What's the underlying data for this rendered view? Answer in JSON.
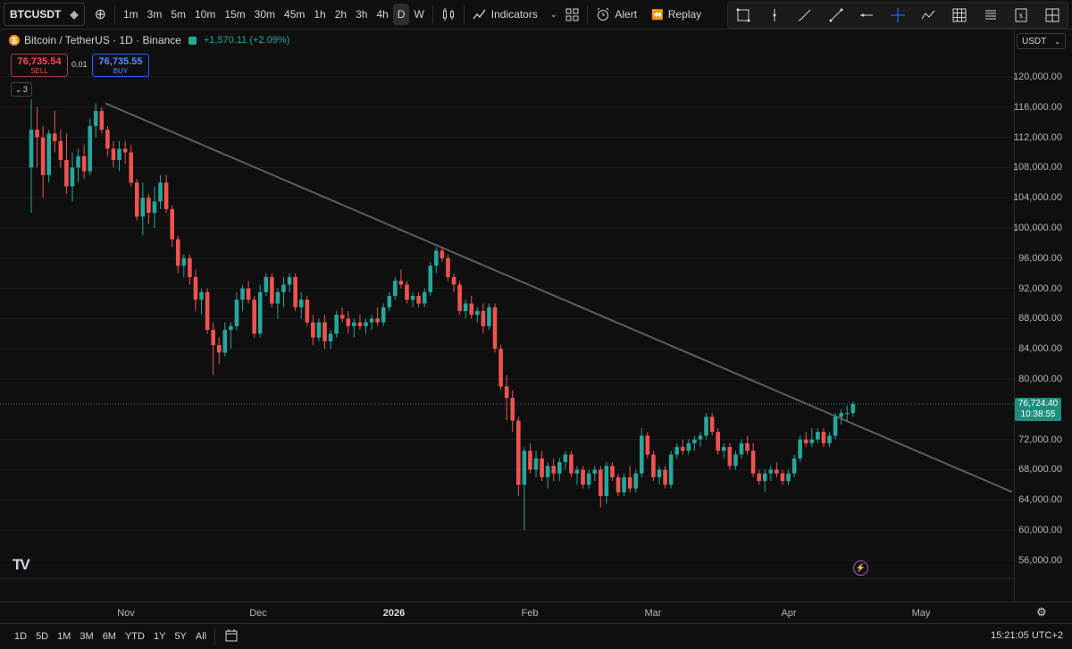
{
  "toolbar": {
    "symbol": "BTCUSDT",
    "intervals": [
      "1m",
      "3m",
      "5m",
      "10m",
      "15m",
      "30m",
      "45m",
      "1h",
      "2h",
      "3h",
      "4h",
      "D",
      "W"
    ],
    "active_interval": "D",
    "indicators_label": "Indicators",
    "alert_label": "Alert",
    "replay_label": "Replay"
  },
  "drawing_tools": [
    "rectangle-icon",
    "vertical-line-icon",
    "brush-icon",
    "trend-line-icon",
    "horizontal-ray-icon",
    "crosshair-icon",
    "path-icon",
    "grid-icon",
    "list-icon",
    "price-range-icon",
    "projection-icon"
  ],
  "legend": {
    "title": "Bitcoin / TetherUS · 1D · Binance",
    "change": "+1,570.11 (+2.09%)"
  },
  "trade": {
    "sell_price": "76,735.54",
    "sell_label": "SELL",
    "spread": "0.01",
    "buy_price": "76,735.55",
    "buy_label": "BUY"
  },
  "indicator_count": "3",
  "currency": "USDT",
  "price_scale": [
    "120,000.00",
    "116,000.00",
    "112,000.00",
    "108,000.00",
    "104,000.00",
    "100,000.00",
    "96,000.00",
    "92,000.00",
    "88,000.00",
    "84,000.00",
    "80,000.00",
    "72,000.00",
    "68,000.00",
    "64,000.00",
    "60,000.00",
    "56,000.00"
  ],
  "last_price": {
    "value": "76,724.40",
    "countdown": "10:38:55"
  },
  "time_scale": [
    {
      "label": "Nov",
      "bold": false
    },
    {
      "label": "Dec",
      "bold": false
    },
    {
      "label": "2026",
      "bold": true
    },
    {
      "label": "Feb",
      "bold": false
    },
    {
      "label": "Mar",
      "bold": false
    },
    {
      "label": "Apr",
      "bold": false
    },
    {
      "label": "May",
      "bold": false
    }
  ],
  "ranges": [
    "1D",
    "5D",
    "1M",
    "3M",
    "6M",
    "YTD",
    "1Y",
    "5Y",
    "All"
  ],
  "clock": "15:21:05 UTC+2",
  "colors": {
    "up": "#26a69a",
    "down": "#ef5350",
    "bg": "#0f0f0f",
    "grid": "#1c1c1c",
    "trendline": "#5d5d5d"
  },
  "chart_data": {
    "type": "candlestick",
    "ylim": [
      55000,
      122000
    ],
    "trendline": [
      [
        0,
        116500
      ],
      [
        160,
        67700
      ]
    ],
    "candles": [
      [
        0,
        108000,
        117000,
        102000,
        113000
      ],
      [
        1,
        113000,
        116000,
        108000,
        112000
      ],
      [
        2,
        112000,
        113500,
        104000,
        107000
      ],
      [
        3,
        107000,
        113000,
        106000,
        112500
      ],
      [
        4,
        112500,
        115500,
        110000,
        111500
      ],
      [
        5,
        111500,
        113000,
        108000,
        109000
      ],
      [
        6,
        109000,
        112500,
        104500,
        105500
      ],
      [
        7,
        105500,
        110000,
        103500,
        108000
      ],
      [
        8,
        108000,
        110500,
        106000,
        109500
      ],
      [
        9,
        109500,
        111000,
        106500,
        107500
      ],
      [
        10,
        107500,
        114500,
        107000,
        113500
      ],
      [
        11,
        113500,
        116500,
        112000,
        115500
      ],
      [
        12,
        115500,
        116000,
        112500,
        113000
      ],
      [
        13,
        113000,
        113500,
        109500,
        110500
      ],
      [
        14,
        110500,
        111500,
        108000,
        109000
      ],
      [
        15,
        109000,
        111500,
        107500,
        110500
      ],
      [
        16,
        110500,
        111500,
        108500,
        110000
      ],
      [
        17,
        110000,
        111000,
        105500,
        106000
      ],
      [
        18,
        106000,
        106500,
        101000,
        101500
      ],
      [
        19,
        101500,
        106000,
        99000,
        104000
      ],
      [
        20,
        104000,
        104500,
        100500,
        102000
      ],
      [
        21,
        102000,
        105500,
        100000,
        103500
      ],
      [
        22,
        103500,
        107000,
        102500,
        106000
      ],
      [
        23,
        106000,
        107000,
        102000,
        102500
      ],
      [
        24,
        102500,
        103000,
        97500,
        98500
      ],
      [
        25,
        98500,
        99000,
        94000,
        95000
      ],
      [
        26,
        95000,
        96500,
        93500,
        96000
      ],
      [
        27,
        96000,
        96500,
        92500,
        93500
      ],
      [
        28,
        93500,
        94500,
        89000,
        90500
      ],
      [
        29,
        90500,
        92000,
        88500,
        91500
      ],
      [
        30,
        91500,
        92000,
        86000,
        86500
      ],
      [
        31,
        86500,
        87500,
        80500,
        84500
      ],
      [
        32,
        84500,
        85500,
        82000,
        83500
      ],
      [
        33,
        83500,
        87500,
        83000,
        86500
      ],
      [
        34,
        86500,
        87500,
        84000,
        87000
      ],
      [
        35,
        87000,
        91500,
        86500,
        90500
      ],
      [
        36,
        90500,
        92500,
        89000,
        92000
      ],
      [
        37,
        92000,
        93000,
        90000,
        90500
      ],
      [
        38,
        90500,
        91000,
        85500,
        86000
      ],
      [
        39,
        86000,
        92500,
        85500,
        91500
      ],
      [
        40,
        91500,
        94000,
        91000,
        93500
      ],
      [
        41,
        93500,
        94000,
        89500,
        90000
      ],
      [
        42,
        90000,
        92000,
        88000,
        91500
      ],
      [
        43,
        91500,
        93500,
        89500,
        92500
      ],
      [
        44,
        92500,
        94000,
        91500,
        93500
      ],
      [
        45,
        93500,
        94000,
        89000,
        89500
      ],
      [
        46,
        89500,
        91500,
        88000,
        90500
      ],
      [
        47,
        90500,
        91000,
        87000,
        87500
      ],
      [
        48,
        87500,
        88500,
        84500,
        85500
      ],
      [
        49,
        85500,
        88000,
        85000,
        87500
      ],
      [
        50,
        87500,
        88500,
        84000,
        85000
      ],
      [
        51,
        85000,
        86500,
        84000,
        86000
      ],
      [
        52,
        86000,
        89000,
        85500,
        88500
      ],
      [
        53,
        88500,
        89500,
        87500,
        88000
      ],
      [
        54,
        88000,
        89000,
        86000,
        87000
      ],
      [
        55,
        87000,
        88000,
        85500,
        87500
      ],
      [
        56,
        87500,
        88500,
        86500,
        87000
      ],
      [
        57,
        87000,
        88000,
        86000,
        87500
      ],
      [
        58,
        87500,
        88500,
        86500,
        88000
      ],
      [
        59,
        88000,
        89500,
        87000,
        87500
      ],
      [
        60,
        87500,
        90000,
        87000,
        89500
      ],
      [
        61,
        89500,
        91500,
        89000,
        91000
      ],
      [
        62,
        91000,
        93500,
        90500,
        93000
      ],
      [
        63,
        93000,
        94500,
        92000,
        92500
      ],
      [
        64,
        92500,
        93000,
        90000,
        90500
      ],
      [
        65,
        90500,
        91500,
        89500,
        91000
      ],
      [
        66,
        91000,
        91500,
        89500,
        90000
      ],
      [
        67,
        90000,
        92000,
        89500,
        91500
      ],
      [
        68,
        91500,
        95500,
        91000,
        95000
      ],
      [
        69,
        95000,
        97500,
        94000,
        97000
      ],
      [
        70,
        97000,
        97500,
        95500,
        96000
      ],
      [
        71,
        96000,
        96500,
        93000,
        93500
      ],
      [
        72,
        93500,
        94000,
        91500,
        92500
      ],
      [
        73,
        92500,
        93000,
        88500,
        89000
      ],
      [
        74,
        89000,
        90500,
        88000,
        90000
      ],
      [
        75,
        90000,
        91000,
        88000,
        88500
      ],
      [
        76,
        88500,
        89500,
        87500,
        89000
      ],
      [
        77,
        89000,
        90000,
        86000,
        87000
      ],
      [
        78,
        87000,
        90000,
        86500,
        89500
      ],
      [
        79,
        89500,
        90000,
        83500,
        84000
      ],
      [
        80,
        84000,
        84500,
        78500,
        79000
      ],
      [
        81,
        79000,
        80500,
        74500,
        77500
      ],
      [
        82,
        77500,
        78500,
        73000,
        74500
      ],
      [
        83,
        74500,
        75000,
        64500,
        66000
      ],
      [
        84,
        66000,
        71000,
        60000,
        70500
      ],
      [
        85,
        70500,
        71500,
        67500,
        68000
      ],
      [
        86,
        68000,
        70500,
        67000,
        69500
      ],
      [
        87,
        69500,
        70500,
        66500,
        67000
      ],
      [
        88,
        67000,
        69000,
        65500,
        68500
      ],
      [
        89,
        68500,
        69500,
        66500,
        67500
      ],
      [
        90,
        67500,
        69500,
        66500,
        69000
      ],
      [
        91,
        69000,
        70500,
        68000,
        70000
      ],
      [
        92,
        70000,
        70500,
        67000,
        67500
      ],
      [
        93,
        67500,
        68500,
        66000,
        68000
      ],
      [
        94,
        68000,
        68500,
        65500,
        66000
      ],
      [
        95,
        66000,
        68000,
        65500,
        67500
      ],
      [
        96,
        67500,
        68500,
        66500,
        68000
      ],
      [
        97,
        68000,
        68500,
        63000,
        64500
      ],
      [
        98,
        64500,
        69000,
        63500,
        68500
      ],
      [
        99,
        68500,
        69000,
        66500,
        67000
      ],
      [
        100,
        67000,
        67500,
        64500,
        65000
      ],
      [
        101,
        65000,
        67500,
        64500,
        67000
      ],
      [
        102,
        67000,
        68500,
        65000,
        65500
      ],
      [
        103,
        65500,
        68000,
        65000,
        67500
      ],
      [
        104,
        67500,
        73500,
        67000,
        72500
      ],
      [
        105,
        72500,
        73000,
        69500,
        70000
      ],
      [
        106,
        70000,
        70500,
        66500,
        67000
      ],
      [
        107,
        67000,
        68500,
        66000,
        68000
      ],
      [
        108,
        68000,
        68500,
        65500,
        66000
      ],
      [
        109,
        66000,
        70500,
        65500,
        70000
      ],
      [
        110,
        70000,
        71500,
        69500,
        71000
      ],
      [
        111,
        71000,
        72000,
        70000,
        70500
      ],
      [
        112,
        70500,
        72000,
        70000,
        71500
      ],
      [
        113,
        71500,
        72500,
        70500,
        72000
      ],
      [
        114,
        72000,
        73000,
        71000,
        72500
      ],
      [
        115,
        72500,
        75500,
        72000,
        75000
      ],
      [
        116,
        75000,
        75500,
        72500,
        73000
      ],
      [
        117,
        73000,
        73500,
        70000,
        70500
      ],
      [
        118,
        70500,
        71500,
        69500,
        71000
      ],
      [
        119,
        71000,
        71500,
        68000,
        68500
      ],
      [
        120,
        68500,
        70500,
        68000,
        70000
      ],
      [
        121,
        70000,
        72000,
        69500,
        71500
      ],
      [
        122,
        71500,
        72500,
        70000,
        70500
      ],
      [
        123,
        70500,
        71500,
        67000,
        67500
      ],
      [
        124,
        67500,
        68000,
        66000,
        66500
      ],
      [
        125,
        66500,
        68000,
        65000,
        67500
      ],
      [
        126,
        67500,
        68500,
        66500,
        68000
      ],
      [
        127,
        68000,
        69000,
        67000,
        67500
      ],
      [
        128,
        67500,
        68000,
        66000,
        66500
      ],
      [
        129,
        66500,
        68000,
        66000,
        67500
      ],
      [
        130,
        67500,
        70000,
        67000,
        69500
      ],
      [
        131,
        69500,
        72500,
        69000,
        72000
      ],
      [
        132,
        72000,
        73000,
        71000,
        71500
      ],
      [
        133,
        71500,
        73500,
        71000,
        72000
      ],
      [
        134,
        72000,
        73500,
        71500,
        73000
      ],
      [
        135,
        73000,
        73500,
        71000,
        71500
      ],
      [
        136,
        71500,
        73000,
        71000,
        72500
      ],
      [
        137,
        72500,
        75500,
        72000,
        75000
      ],
      [
        138,
        75000,
        76000,
        74000,
        75500
      ],
      [
        139,
        75500,
        76500,
        74500,
        75500
      ],
      [
        140,
        75500,
        77000,
        75000,
        76700
      ]
    ]
  }
}
